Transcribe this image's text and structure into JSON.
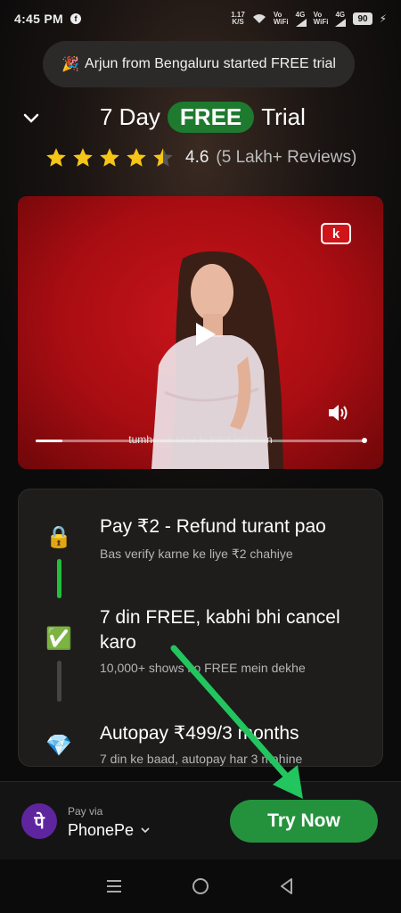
{
  "status_bar": {
    "time": "4:45 PM",
    "app_icon": "facebook-icon",
    "net_speed_value": "1.17",
    "net_speed_unit": "K/S",
    "sim1_top": "Vo",
    "sim1_bottom": "WiFi",
    "net1": "4G",
    "sim2_top": "Vo",
    "sim2_bottom": "WiFi",
    "net2": "4G",
    "battery": "90"
  },
  "toast": {
    "icon": "party-popper-icon",
    "text": "Arjun from Bengaluru started FREE trial"
  },
  "header": {
    "title_prefix": "7 Day",
    "title_badge": "FREE",
    "title_suffix": "Trial",
    "rating_value": "4.6",
    "rating_reviews": "(5 Lakh+ Reviews)",
    "stars": 4.5,
    "star_color": "#f5c518"
  },
  "video": {
    "logo_letter": "k",
    "subtitle": "tumhe ek raaz ki baat bataoon",
    "progress": 0.08
  },
  "steps": [
    {
      "icon": "lock-icon",
      "title": "Pay ₹2 - Refund turant pao",
      "subtitle": "Bas verify karne ke liye ₹2 chahiye"
    },
    {
      "icon": "check-box-icon",
      "title": "7 din FREE, kabhi bhi cancel karo",
      "subtitle": "10,000+ shows ko FREE mein dekhe"
    },
    {
      "icon": "diamond-icon",
      "title": "Autopay ₹499/3 months",
      "subtitle": "7 din ke baad, autopay har 3 mahine"
    }
  ],
  "payment": {
    "pay_via_label": "Pay via",
    "method": "PhonePe",
    "logo_letter": "पे",
    "cta": "Try Now"
  },
  "colors": {
    "accent_green": "#24923d",
    "free_badge": "#1e7a2e",
    "video_red": "#c7141b",
    "phonepe_purple": "#5f259f",
    "annotation_arrow": "#22c55e"
  }
}
